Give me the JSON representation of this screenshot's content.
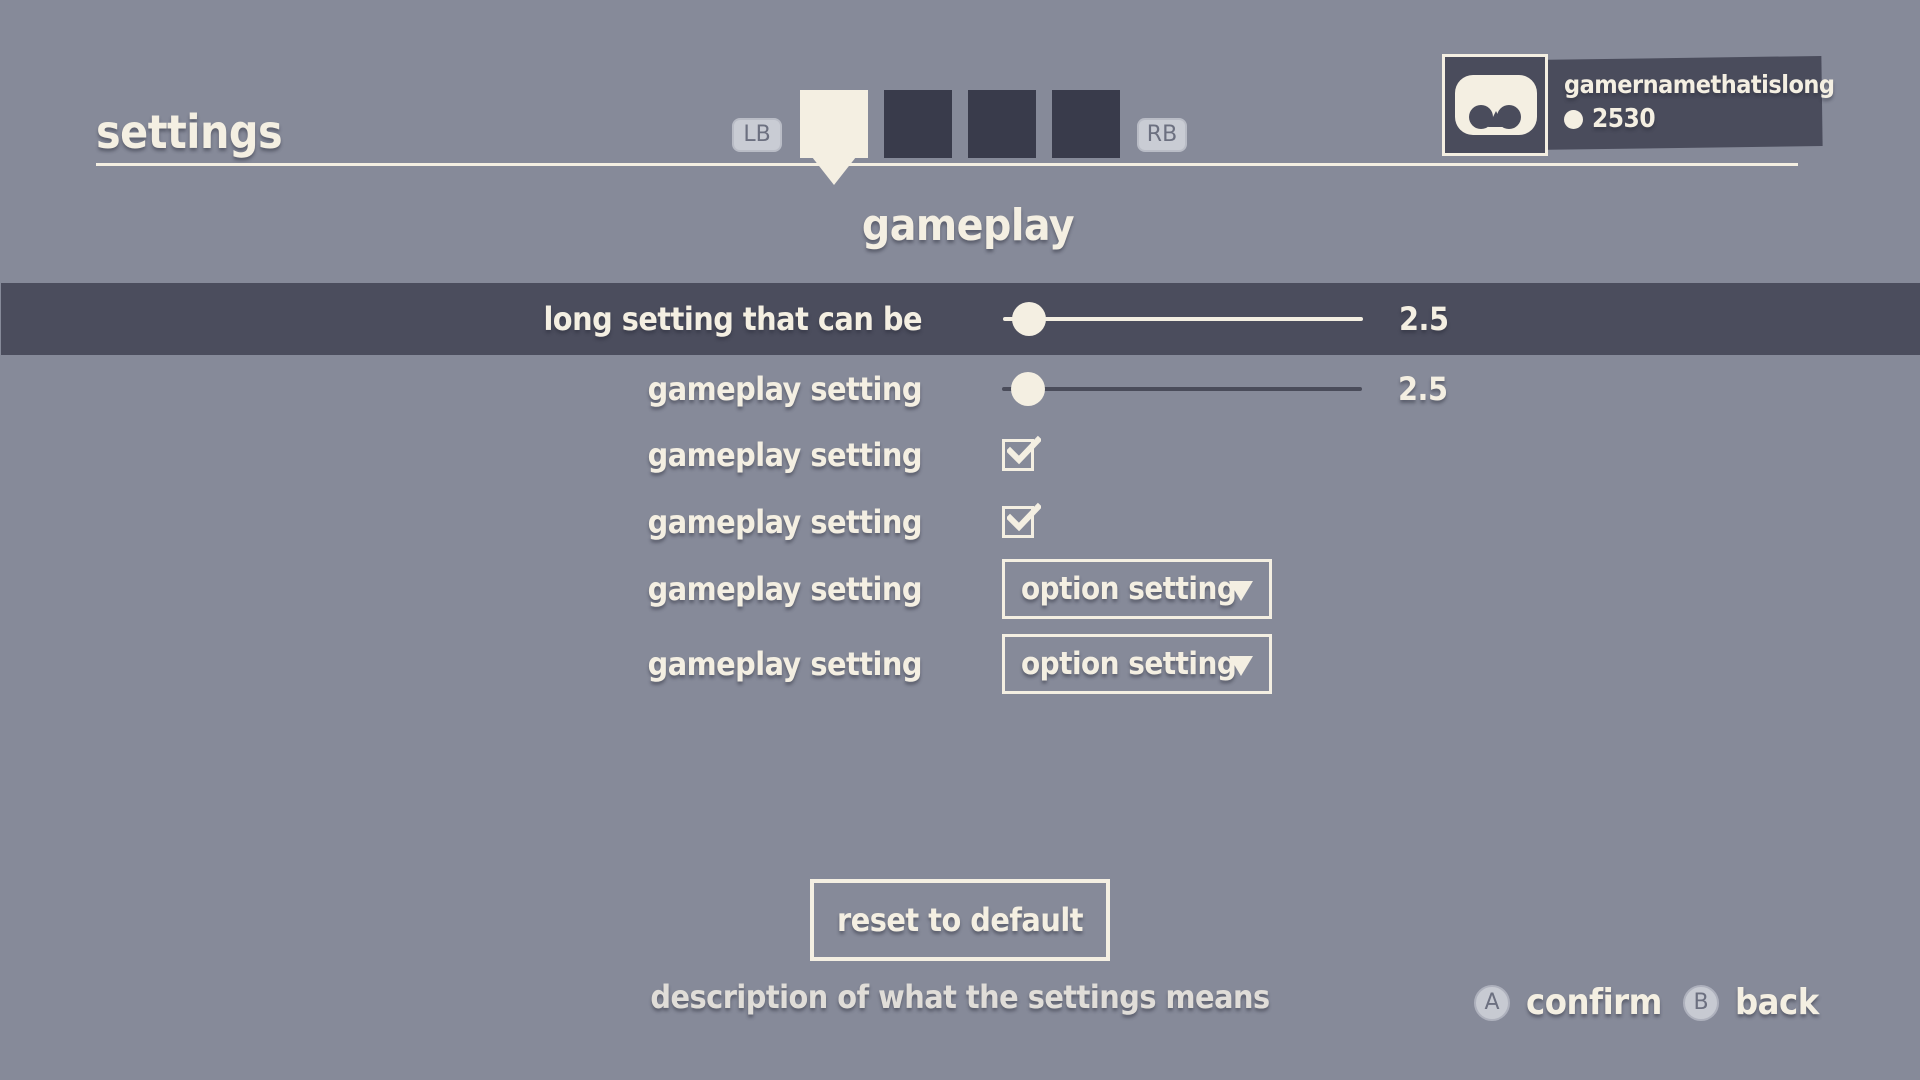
{
  "header": {
    "title": "settings",
    "bumper_left": "LB",
    "bumper_right": "RB",
    "tabs": [
      {
        "active": true
      },
      {
        "active": false
      },
      {
        "active": false
      },
      {
        "active": false
      }
    ]
  },
  "profile": {
    "gamername": "gamernamethatislong",
    "coins": "2530"
  },
  "section": {
    "title": "gameplay"
  },
  "settings": {
    "rows": [
      {
        "label": "long setting that can be",
        "type": "slider",
        "value": "2.5",
        "level": 0.06,
        "selected": true
      },
      {
        "label": "gameplay setting",
        "type": "slider",
        "value": "2.5",
        "level": 0.06,
        "selected": false
      },
      {
        "label": "gameplay setting",
        "type": "checkbox",
        "checked": true
      },
      {
        "label": "gameplay setting",
        "type": "checkbox",
        "checked": true
      },
      {
        "label": "gameplay setting",
        "type": "dropdown",
        "selected_option": "option setting"
      },
      {
        "label": "gameplay setting",
        "type": "dropdown",
        "selected_option": "option setting"
      }
    ]
  },
  "footer": {
    "reset_label": "reset to default",
    "description": "description of what the settings means",
    "confirm_button": "A",
    "confirm_label": "confirm",
    "back_button": "B",
    "back_label": "back"
  },
  "colors": {
    "background": "#868a99",
    "panel_dark": "#4b4d5d",
    "tab_dark": "#393b4b",
    "text_cream": "#f4efe2"
  }
}
